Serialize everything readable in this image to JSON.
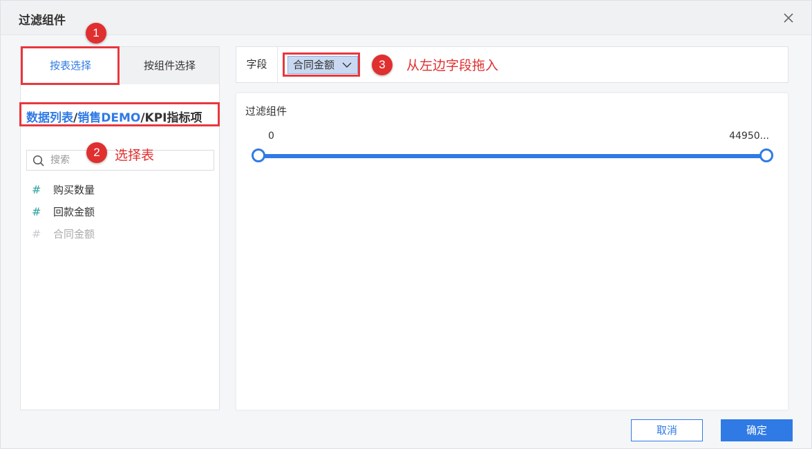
{
  "dialog": {
    "title": "过滤组件",
    "close_icon": "close-icon"
  },
  "left_panel": {
    "tabs": [
      {
        "label": "按表选择",
        "active": true
      },
      {
        "label": "按组件选择",
        "active": false
      }
    ],
    "breadcrumb": {
      "part1": "数据列表",
      "sep1": "/",
      "part2": "销售DEMO",
      "sep2": "/",
      "current": "KPI指标项"
    },
    "search": {
      "placeholder": "搜索",
      "value": ""
    },
    "fields": [
      {
        "icon": "#",
        "name": "购买数量",
        "disabled": false
      },
      {
        "icon": "#",
        "name": "回款金额",
        "disabled": false
      },
      {
        "icon": "#",
        "name": "合同金额",
        "disabled": true
      }
    ]
  },
  "field_bar": {
    "label": "字段",
    "chip": "合同金额"
  },
  "preview": {
    "title": "过滤组件",
    "slider": {
      "min_label": "0",
      "max_label": "44950...",
      "range_low": 0.0,
      "range_high": 1.0
    }
  },
  "footer": {
    "cancel": "取消",
    "ok": "确定"
  },
  "annotations": {
    "n1": "1",
    "n2": "2",
    "n3": "3",
    "text2": "选择表",
    "text3": "从左边字段拖入"
  },
  "colors": {
    "accent": "#2f7ae5",
    "annotation": "#e02f2f",
    "field_icon": "#2ea3a1"
  }
}
